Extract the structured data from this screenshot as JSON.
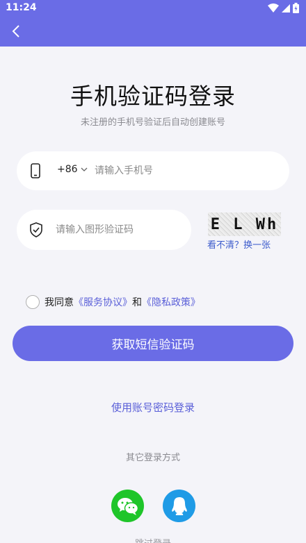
{
  "status_bar": {
    "time": "11:24"
  },
  "header": {
    "back_icon": "chevron-left-icon"
  },
  "main": {
    "title": "手机验证码登录",
    "subtitle": "未注册的手机号验证后自动创建账号",
    "phone": {
      "country_code": "+86",
      "placeholder": "请输入手机号",
      "value": ""
    },
    "captcha": {
      "placeholder": "请输入图形验证码",
      "value": "",
      "image_text": "E L Wh",
      "refresh_label": "看不清？换一张"
    },
    "agreement": {
      "prefix": "我同意",
      "service_link": "《服务协议》",
      "conjunction": "和",
      "privacy_link": "《隐私政策》",
      "checked": false
    },
    "get_code_button": "获取短信验证码",
    "password_login_link": "使用账号密码登录",
    "other_login_label": "其它登录方式",
    "social": [
      {
        "name": "wechat",
        "icon": "wechat-icon",
        "color": "#1fc52a"
      },
      {
        "name": "qq",
        "icon": "qq-icon",
        "color": "#1f9be6"
      }
    ],
    "skip_login": "跳过登录"
  },
  "colors": {
    "primary": "#6a6ce6",
    "link": "#5a5fd8",
    "background": "#f4f4f9"
  }
}
